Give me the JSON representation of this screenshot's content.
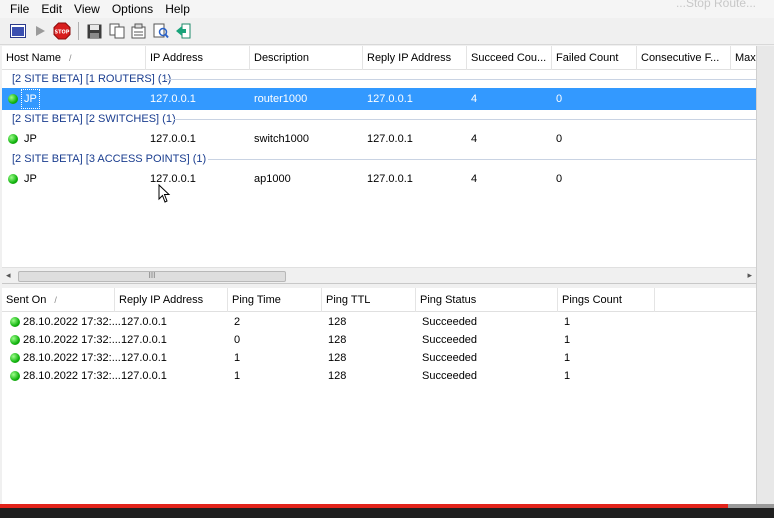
{
  "menu": [
    "File",
    "Edit",
    "View",
    "Options",
    "Help"
  ],
  "faded_corner_text": "...Stop Route...",
  "toolbar": {
    "icons": [
      "window-icon",
      "play-icon",
      "stop-icon",
      "save-icon",
      "copy-icon",
      "properties-icon",
      "find-icon",
      "exit-icon"
    ],
    "stop_label": "STOP"
  },
  "hosts": {
    "columns": [
      "Host Name",
      "IP Address",
      "Description",
      "Reply IP Address",
      "Succeed Cou...",
      "Failed Count",
      "Consecutive F...",
      "Max"
    ],
    "groups": [
      {
        "label": "[2 SITE BETA] [1 ROUTERS]  (1)",
        "rows": [
          {
            "host": "JP",
            "ip": "127.0.0.1",
            "desc": "router1000",
            "reply": "127.0.0.1",
            "succeed": "4",
            "failed": "0",
            "selected": true
          }
        ]
      },
      {
        "label": "[2 SITE BETA] [2 SWITCHES]  (1)",
        "rows": [
          {
            "host": "JP",
            "ip": "127.0.0.1",
            "desc": "switch1000",
            "reply": "127.0.0.1",
            "succeed": "4",
            "failed": "0",
            "selected": false
          }
        ]
      },
      {
        "label": "[2 SITE BETA] [3 ACCESS POINTS]  (1)",
        "rows": [
          {
            "host": "JP",
            "ip": "127.0.0.1",
            "desc": "ap1000",
            "reply": "127.0.0.1",
            "succeed": "4",
            "failed": "0",
            "selected": false
          }
        ]
      }
    ]
  },
  "pings": {
    "columns": [
      "Sent On",
      "Reply IP Address",
      "Ping Time",
      "Ping TTL",
      "Ping Status",
      "Pings Count"
    ],
    "rows": [
      {
        "sent": "28.10.2022 17:32:...",
        "reply": "127.0.0.1",
        "time": "2",
        "ttl": "128",
        "status": "Succeeded",
        "count": "1"
      },
      {
        "sent": "28.10.2022 17:32:...",
        "reply": "127.0.0.1",
        "time": "0",
        "ttl": "128",
        "status": "Succeeded",
        "count": "1"
      },
      {
        "sent": "28.10.2022 17:32:...",
        "reply": "127.0.0.1",
        "time": "1",
        "ttl": "128",
        "status": "Succeeded",
        "count": "1"
      },
      {
        "sent": "28.10.2022 17:32:...",
        "reply": "127.0.0.1",
        "time": "1",
        "ttl": "128",
        "status": "Succeeded",
        "count": "1"
      }
    ]
  },
  "colors": {
    "selection": "#3399ff",
    "status_green": "#12b30e",
    "group_text": "#1a3d8f",
    "progress_red": "#e2231a"
  },
  "video_progress": 0.94,
  "scroll_grip": "III"
}
